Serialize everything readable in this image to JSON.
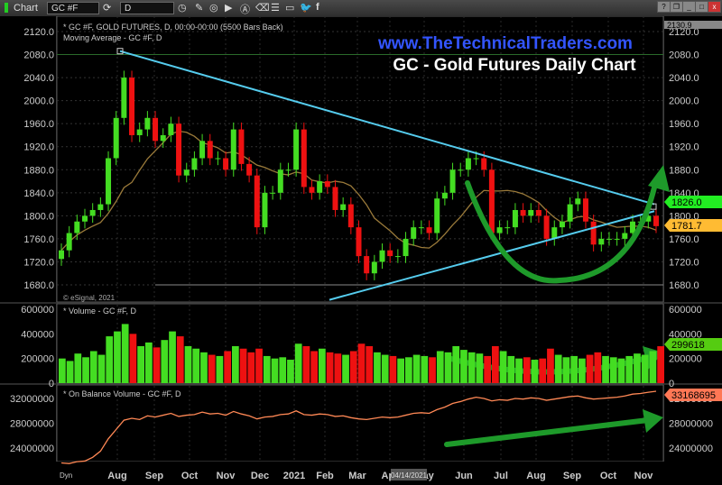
{
  "window": {
    "title": "Chart",
    "symbol": "GC #F",
    "interval": "D",
    "buttons": [
      "?",
      "❐",
      "_",
      "□",
      "x"
    ]
  },
  "toolbar_icons": [
    "refresh-icon",
    "clock-icon",
    "pencil-icon",
    "indicator-icon",
    "play-icon",
    "alert-icon",
    "eraser-icon",
    "list-icon",
    "comment-icon",
    "twitter-icon",
    "facebook-icon"
  ],
  "header": {
    "website": "www.TheTechnicalTraders.com",
    "title": "GC - Gold Futures Daily Chart",
    "symbol_info": "* GC #F, GOLD FUTURES, D, 00:00-00:00 (5500 Bars Back)",
    "ma_label": "Moving Average - GC #F, D",
    "copyright": "© eSignal, 2021",
    "top_price": "2130.9"
  },
  "colors": {
    "up": "#44dd22",
    "down": "#ee1111",
    "trendline": "#55ccee",
    "ma": "#9a7a3a",
    "obv": "#ff8855",
    "arrow": "#1e9a2a",
    "website": "#3355ff"
  },
  "chart_data": [
    {
      "type": "candlestick",
      "title": "GC - Gold Futures Daily Chart",
      "ylim": [
        1660,
        2140
      ],
      "yticks": [
        1680,
        1720,
        1760,
        1800,
        1840,
        1880,
        1920,
        1960,
        2000,
        2040,
        2080,
        2120
      ],
      "x_start": "2020-06-15",
      "x_interval": "week",
      "closes": [
        1740,
        1770,
        1790,
        1800,
        1810,
        1820,
        1900,
        1970,
        2040,
        1940,
        1950,
        1970,
        1930,
        1940,
        1960,
        1870,
        1880,
        1900,
        1930,
        1900,
        1900,
        1880,
        1950,
        1890,
        1870,
        1780,
        1840,
        1840,
        1880,
        1880,
        1950,
        1850,
        1840,
        1860,
        1850,
        1810,
        1820,
        1780,
        1730,
        1700,
        1720,
        1740,
        1730,
        1730,
        1760,
        1780,
        1780,
        1770,
        1830,
        1840,
        1880,
        1880,
        1900,
        1900,
        1880,
        1770,
        1780,
        1780,
        1810,
        1800,
        1810,
        1800,
        1760,
        1780,
        1790,
        1820,
        1830,
        1790,
        1750,
        1760,
        1760,
        1760,
        1770,
        1790,
        1790,
        1800,
        1782
      ],
      "labels": {
        "last": "1781.7",
        "trend_value": "1826.0"
      }
    },
    {
      "type": "bar",
      "title": "* Volume - GC #F, D",
      "ylim": [
        0,
        600000
      ],
      "yticks": [
        "0",
        "200000",
        "400000",
        "600000"
      ],
      "values": [
        200000,
        180000,
        240000,
        210000,
        260000,
        230000,
        380000,
        420000,
        480000,
        400000,
        300000,
        330000,
        290000,
        350000,
        420000,
        380000,
        300000,
        280000,
        250000,
        230000,
        220000,
        260000,
        300000,
        280000,
        250000,
        280000,
        220000,
        200000,
        210000,
        190000,
        320000,
        300000,
        260000,
        280000,
        250000,
        240000,
        230000,
        260000,
        320000,
        300000,
        250000,
        230000,
        220000,
        200000,
        210000,
        230000,
        220000,
        210000,
        260000,
        250000,
        300000,
        270000,
        250000,
        240000,
        220000,
        300000,
        260000,
        220000,
        200000,
        210000,
        190000,
        200000,
        280000,
        230000,
        210000,
        220000,
        200000,
        230000,
        250000,
        220000,
        210000,
        200000,
        220000,
        240000,
        230000,
        260000,
        299618
      ],
      "labels": {
        "last": "299618"
      }
    },
    {
      "type": "line",
      "title": "* On Balance Volume - GC #F, D",
      "ylim": [
        21000000,
        34000000
      ],
      "yticks": [
        "24000000",
        "28000000",
        "32000000"
      ],
      "values": [
        21600000,
        21500000,
        21800000,
        21900000,
        22500000,
        23500000,
        25500000,
        27000000,
        28500000,
        28800000,
        28600000,
        29200000,
        29000000,
        29300000,
        29600000,
        29100000,
        29300000,
        29400000,
        29800000,
        29500000,
        29600000,
        29300000,
        29900000,
        29500000,
        29200000,
        28700000,
        29000000,
        29100000,
        29400000,
        29500000,
        30000000,
        29400000,
        29300000,
        29500000,
        29400000,
        29100000,
        29200000,
        28900000,
        28700000,
        28600000,
        28800000,
        29000000,
        28900000,
        29000000,
        29300000,
        29600000,
        29700000,
        29600000,
        30200000,
        30600000,
        31200000,
        31500000,
        31900000,
        32200000,
        32000000,
        31600000,
        31800000,
        31700000,
        32000000,
        31900000,
        32100000,
        32000000,
        31700000,
        31900000,
        32100000,
        32300000,
        32400000,
        32100000,
        31900000,
        32000000,
        32100000,
        32200000,
        32400000,
        32700000,
        32800000,
        33000000,
        33168695
      ],
      "labels": {
        "last": "33168695"
      }
    },
    {
      "type": "axis",
      "x_ticks": [
        "Aug",
        "Sep",
        "Oct",
        "Nov",
        "Dec",
        "2021",
        "Feb",
        "Mar",
        "Apr",
        "May",
        "Jun",
        "Jul",
        "Aug",
        "Sep",
        "Oct",
        "Nov"
      ],
      "cursor_date": "04/14/2021",
      "dyn_label": "Dyn"
    }
  ]
}
